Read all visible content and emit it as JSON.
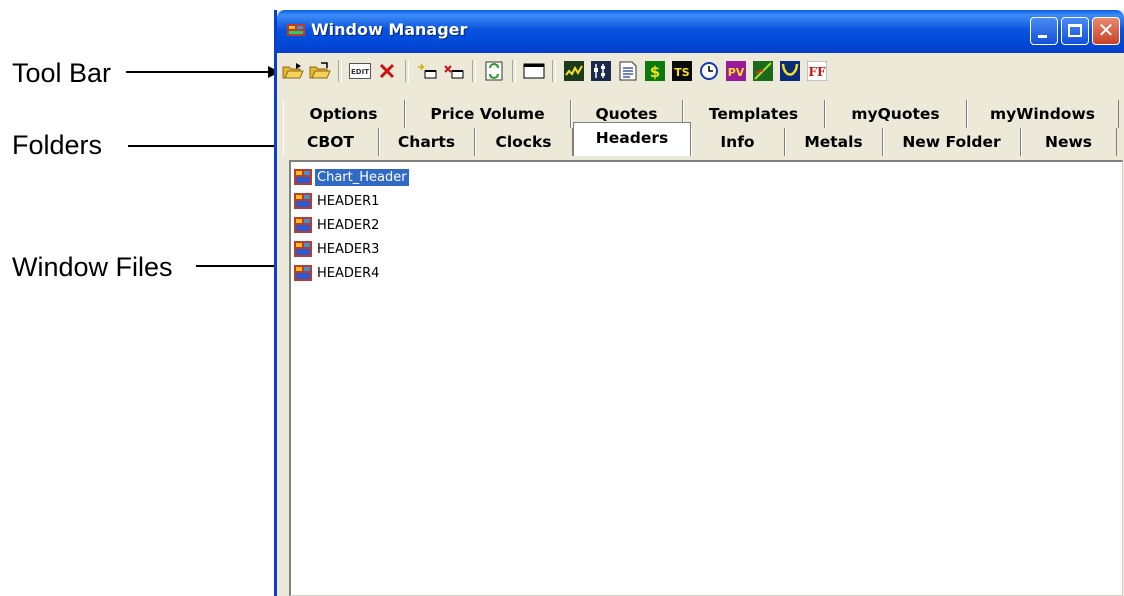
{
  "callouts": {
    "toolbar": "Tool Bar",
    "folders": "Folders",
    "window_files": "Window Files"
  },
  "window": {
    "title": "Window Manager"
  },
  "toolbar": {
    "buttons": [
      "open-folder",
      "open",
      "edit",
      "delete",
      "new",
      "close",
      "refresh",
      "window",
      "chart",
      "price-volume",
      "notes",
      "quotes",
      "time-sales",
      "clock",
      "pv",
      "trend",
      "indicator",
      "ff"
    ],
    "edit_label": "EDIT",
    "ts_label": "TS",
    "pv_label": "PV",
    "ff_label": "FF",
    "dollar_label": "$"
  },
  "tabs": {
    "top": [
      "Options",
      "Price Volume",
      "Quotes",
      "Templates",
      "myQuotes",
      "myWindows"
    ],
    "bottom": [
      "CBOT",
      "Charts",
      "Clocks",
      "Headers",
      "Info",
      "Metals",
      "New Folder",
      "News"
    ],
    "active": "Headers"
  },
  "files": [
    {
      "name": "Chart_Header",
      "selected": true
    },
    {
      "name": "HEADER1",
      "selected": false
    },
    {
      "name": "HEADER2",
      "selected": false
    },
    {
      "name": "HEADER3",
      "selected": false
    },
    {
      "name": "HEADER4",
      "selected": false
    }
  ],
  "colors": {
    "titlebar": "#0a54e0",
    "selection": "#316ac5",
    "window_face": "#ece9d8"
  }
}
